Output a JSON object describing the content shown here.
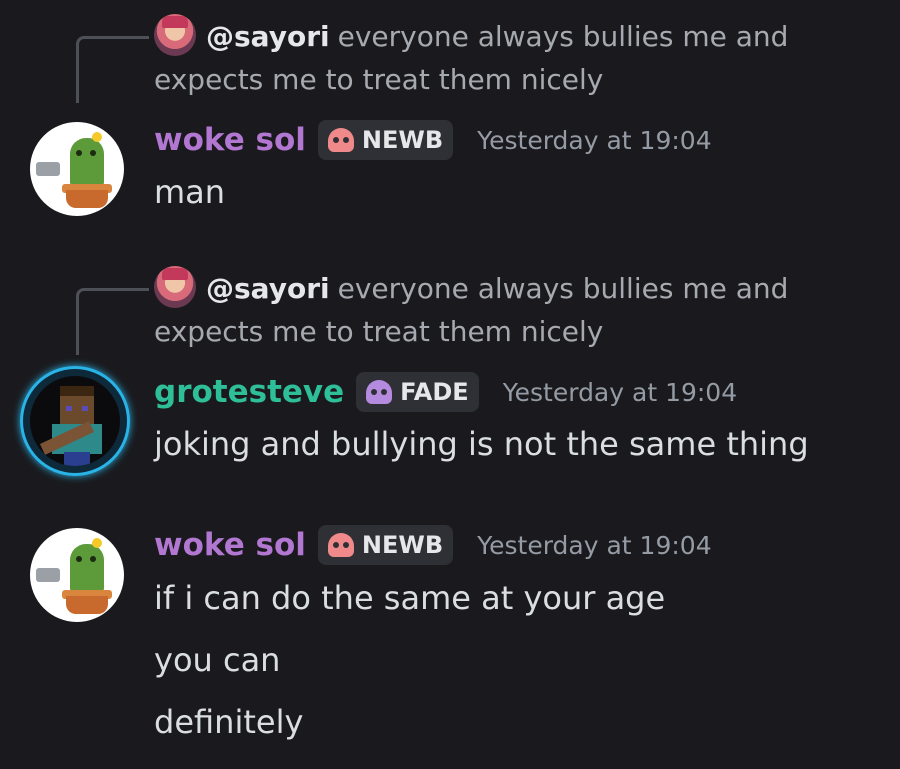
{
  "messages": [
    {
      "reply": {
        "mention": "@sayori",
        "text": "everyone always bullies me and expects me to treat them nicely"
      },
      "author": "woke sol",
      "tag": "NEWB",
      "timestamp": "Yesterday at 19:04",
      "lines": [
        "man"
      ]
    },
    {
      "reply": {
        "mention": "@sayori",
        "text": "everyone always bullies me and expects me to treat them nicely"
      },
      "author": "grotesteve",
      "tag": "FADE",
      "timestamp": "Yesterday at 19:04",
      "lines": [
        "joking and bullying is not the same thing"
      ]
    },
    {
      "author": "woke sol",
      "tag": "NEWB",
      "timestamp": "Yesterday at 19:04",
      "lines": [
        "if i can do the same at your age",
        "you can",
        "definitely"
      ]
    }
  ],
  "colors": {
    "background": "#1a1a1e",
    "woke_sol_name": "#b277d1",
    "grotesteve_name": "#2fbf98",
    "newb_skull": "#f08a8a",
    "fade_skull": "#b58be0",
    "avatar_ring": "#2ab3e6"
  },
  "icons": {
    "newb_tag_icon": "skull-icon",
    "fade_tag_icon": "skull-icon"
  }
}
